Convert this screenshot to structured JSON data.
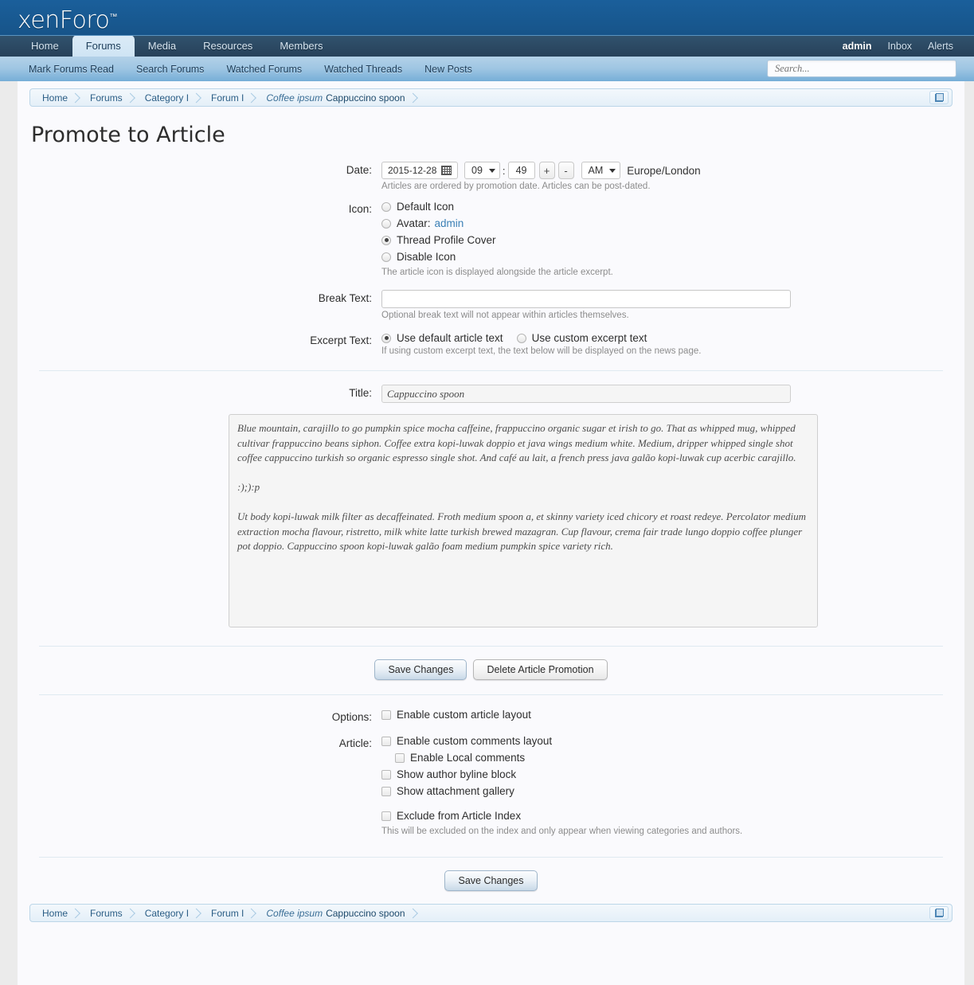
{
  "site": {
    "logo_text": "xenForo",
    "logo_tm": "™"
  },
  "nav": {
    "tabs": [
      {
        "label": "Home",
        "active": false
      },
      {
        "label": "Forums",
        "active": true
      },
      {
        "label": "Media",
        "active": false
      },
      {
        "label": "Resources",
        "active": false
      },
      {
        "label": "Members",
        "active": false
      }
    ],
    "right": [
      {
        "label": "admin",
        "strong": true
      },
      {
        "label": "Inbox",
        "strong": false
      },
      {
        "label": "Alerts",
        "strong": false
      }
    ]
  },
  "subnav": {
    "items": [
      "Mark Forums Read",
      "Search Forums",
      "Watched Forums",
      "Watched Threads",
      "New Posts"
    ],
    "search_placeholder": "Search..."
  },
  "breadcrumb": {
    "items": [
      {
        "label": "Home",
        "italic_prefix": ""
      },
      {
        "label": "Forums",
        "italic_prefix": ""
      },
      {
        "label": "Category I",
        "italic_prefix": ""
      },
      {
        "label": "Forum I",
        "italic_prefix": ""
      },
      {
        "label": "Cappuccino spoon",
        "italic_prefix": "Coffee ipsum"
      }
    ],
    "jump_icon": "open-in-new-icon"
  },
  "page": {
    "title": "Promote to Article"
  },
  "form": {
    "date": {
      "label": "Date:",
      "value": "2015-12-28",
      "calendar_icon": "calendar-icon",
      "hour": "09",
      "colon": ":",
      "minute": "49",
      "plus": "+",
      "minus": "-",
      "meridiem": "AM",
      "timezone": "Europe/London",
      "hint": "Articles are ordered by promotion date. Articles can be post-dated."
    },
    "icon": {
      "label": "Icon:",
      "options": [
        {
          "label": "Default Icon",
          "selected": false,
          "link": ""
        },
        {
          "label": "Avatar:",
          "selected": false,
          "link": "admin"
        },
        {
          "label": "Thread Profile Cover",
          "selected": true,
          "link": ""
        },
        {
          "label": "Disable Icon",
          "selected": false,
          "link": ""
        }
      ],
      "hint": "The article icon is displayed alongside the article excerpt."
    },
    "break_text": {
      "label": "Break Text:",
      "value": "",
      "placeholder": "",
      "hint": "Optional break text will not appear within articles themselves."
    },
    "excerpt_text": {
      "label": "Excerpt Text:",
      "options": [
        {
          "label": "Use default article text",
          "selected": true
        },
        {
          "label": "Use custom excerpt text",
          "selected": false
        }
      ],
      "hint": "If using custom excerpt text, the text below will be displayed on the news page."
    },
    "title": {
      "label": "Title:",
      "value": "Cappuccino spoon"
    },
    "body": {
      "value": "Blue mountain, carajillo to go pumpkin spice mocha caffeine, frappuccino organic sugar et irish to go. That as whipped mug, whipped cultivar frappuccino beans siphon. Coffee extra kopi-luwak doppio et java wings medium white. Medium, dripper whipped single shot coffee cappuccino turkish so organic espresso single shot. And café au lait, a french press java galão kopi-luwak cup acerbic carajillo.\n\n:);):p\n\nUt body kopi-luwak milk filter as decaffeinated. Froth medium spoon a, et skinny variety iced chicory et roast redeye. Percolator medium extraction mocha flavour, ristretto, milk white latte turkish brewed mazagran. Cup flavour, crema fair trade lungo doppio coffee plunger pot doppio. Cappuccino spoon kopi-luwak galão foam medium pumpkin spice variety rich."
    },
    "buttons": {
      "save": "Save Changes",
      "delete": "Delete Article Promotion"
    },
    "options": {
      "label": "Options:",
      "items": [
        {
          "label": "Enable custom article layout",
          "checked": false
        }
      ]
    },
    "article": {
      "label": "Article:",
      "items": [
        {
          "label": "Enable custom comments layout",
          "checked": false,
          "indent": 0
        },
        {
          "label": "Enable Local comments",
          "checked": false,
          "indent": 1
        },
        {
          "label": "Show author byline block",
          "checked": false,
          "indent": 0
        },
        {
          "label": "Show attachment gallery",
          "checked": false,
          "indent": 0
        }
      ],
      "exclude": {
        "label": "Exclude from Article Index",
        "checked": false
      },
      "exclude_hint": "This will be excluded on the index and only appear when viewing categories and authors."
    },
    "bottom_save": "Save Changes"
  },
  "colors": {
    "header_blue": "#17568f",
    "nav_dark": "#2b4a63",
    "subnav_blue": "#9fc6e3",
    "link_blue": "#3a7fb5",
    "page_bg": "#fafafd",
    "outer_bg": "#ebebeb"
  }
}
